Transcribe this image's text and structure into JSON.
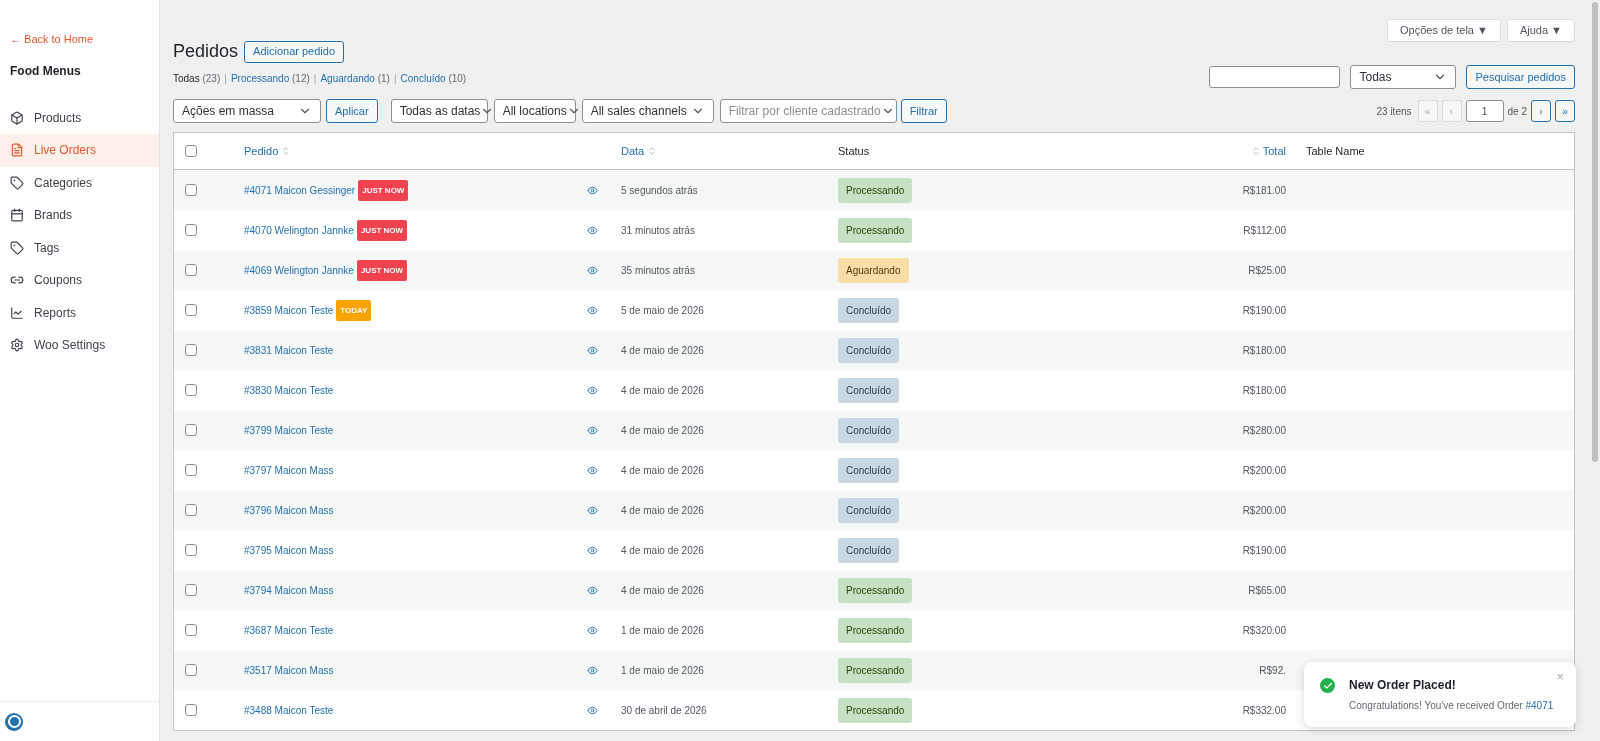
{
  "sidebar": {
    "back_link": "← Back to Home",
    "title": "Food Menus",
    "items": [
      {
        "label": "Products",
        "selected": false
      },
      {
        "label": "Live Orders",
        "selected": true
      },
      {
        "label": "Categories",
        "selected": false
      },
      {
        "label": "Brands",
        "selected": false
      },
      {
        "label": "Tags",
        "selected": false
      },
      {
        "label": "Coupons",
        "selected": false
      },
      {
        "label": "Reports",
        "selected": false
      },
      {
        "label": "Woo Settings",
        "selected": false
      }
    ]
  },
  "top_buttons": [
    "Opções de tela ▼",
    "Ajuda ▼"
  ],
  "page_title": "Pedidos",
  "add_button": "Adicionar pedido",
  "views": [
    {
      "label": "Todas",
      "count": "(23)",
      "selected": true
    },
    {
      "separator": "|",
      "label": "Processando",
      "count": "(12)",
      "selected": false
    },
    {
      "separator": "|",
      "label": "Aguardando",
      "count": "(1)",
      "selected": false
    },
    {
      "separator": "|",
      "label": "Concluído",
      "count": "(10)",
      "selected": false
    }
  ],
  "search": {
    "scope": "Todas",
    "button": "Pesquisar pedidos"
  },
  "filters": {
    "bulk_action": "Ações em massa",
    "apply": "Aplicar",
    "dates": "Todas as datas",
    "locations": "All locations",
    "channels": "All sales channels",
    "customer_placeholder": "Filtrar por cliente cadastrado",
    "filter": "Filtrar"
  },
  "pagination": {
    "count": "23 itens",
    "page": "1",
    "of": "de 2",
    "buttons": [
      {
        "label": "«",
        "disabled": true
      },
      {
        "label": "‹",
        "disabled": true
      },
      {
        "label": "›",
        "disabled": false
      },
      {
        "label": "»",
        "disabled": false
      }
    ]
  },
  "table": {
    "select_all": {
      "checked": false
    },
    "columns": [
      "Pedido",
      "Data",
      "Status",
      "Total",
      "Table Name"
    ],
    "rows": [
      {
        "order": "#4071 Maicon Gessinger",
        "badge": {
          "kind": "just_now",
          "label": "JUST NOW"
        },
        "date": "5 segundos atrás",
        "status": {
          "kind": "processing",
          "label": "Processando"
        },
        "total": "R$181.00",
        "checked": false
      },
      {
        "order": "#4070 Welington Jannke",
        "badge": {
          "kind": "just_now",
          "label": "JUST NOW"
        },
        "date": "31 minutos atrás",
        "status": {
          "kind": "processing",
          "label": "Processando"
        },
        "total": "R$112.00",
        "checked": false
      },
      {
        "order": "#4069 Welington Jannke",
        "badge": {
          "kind": "just_now",
          "label": "JUST NOW"
        },
        "date": "35 minutos atrás",
        "status": {
          "kind": "on_hold",
          "label": "Aguardando"
        },
        "total": "R$25.00",
        "checked": false
      },
      {
        "order": "#3859 Maicon Teste",
        "badge": {
          "kind": "today",
          "label": "TODAY"
        },
        "date": "5 de maio de 2026",
        "status": {
          "kind": "completed",
          "label": "Concluído"
        },
        "total": "R$190.00",
        "checked": false
      },
      {
        "order": "#3831 Maicon Teste",
        "date": "4 de maio de 2026",
        "status": {
          "kind": "completed",
          "label": "Concluído"
        },
        "total": "R$180.00",
        "checked": false
      },
      {
        "order": "#3830 Maicon Teste",
        "date": "4 de maio de 2026",
        "status": {
          "kind": "completed",
          "label": "Concluído"
        },
        "total": "R$180.00",
        "checked": false
      },
      {
        "order": "#3799 Maicon Teste",
        "date": "4 de maio de 2026",
        "status": {
          "kind": "completed",
          "label": "Concluído"
        },
        "total": "R$280.00",
        "checked": false
      },
      {
        "order": "#3797 Maicon Mass",
        "date": "4 de maio de 2026",
        "status": {
          "kind": "completed",
          "label": "Concluído"
        },
        "total": "R$200.00",
        "checked": false
      },
      {
        "order": "#3796 Maicon Mass",
        "date": "4 de maio de 2026",
        "status": {
          "kind": "completed",
          "label": "Concluído"
        },
        "total": "R$200.00",
        "checked": false
      },
      {
        "order": "#3795 Maicon Mass",
        "date": "4 de maio de 2026",
        "status": {
          "kind": "completed",
          "label": "Concluído"
        },
        "total": "R$190.00",
        "checked": false
      },
      {
        "order": "#3794 Maicon Mass",
        "date": "4 de maio de 2026",
        "status": {
          "kind": "processing",
          "label": "Processando"
        },
        "total": "R$65.00",
        "checked": false
      },
      {
        "order": "#3687 Maicon Teste",
        "date": "1 de maio de 2026",
        "status": {
          "kind": "processing",
          "label": "Processando"
        },
        "total": "R$320.00",
        "checked": false
      },
      {
        "order": "#3517 Maicon Mass",
        "date": "1 de maio de 2026",
        "status": {
          "kind": "processing",
          "label": "Processando"
        },
        "total": "R$92.",
        "checked": false
      },
      {
        "order": "#3488 Maicon Teste",
        "date": "30 de abril de 2026",
        "status": {
          "kind": "processing",
          "label": "Processando"
        },
        "total": "R$332.00",
        "checked": false
      }
    ]
  },
  "toast": {
    "title": "New Order Placed!",
    "message": "Congratulations! You've received Order ",
    "link": "#4071",
    "close": "×"
  }
}
